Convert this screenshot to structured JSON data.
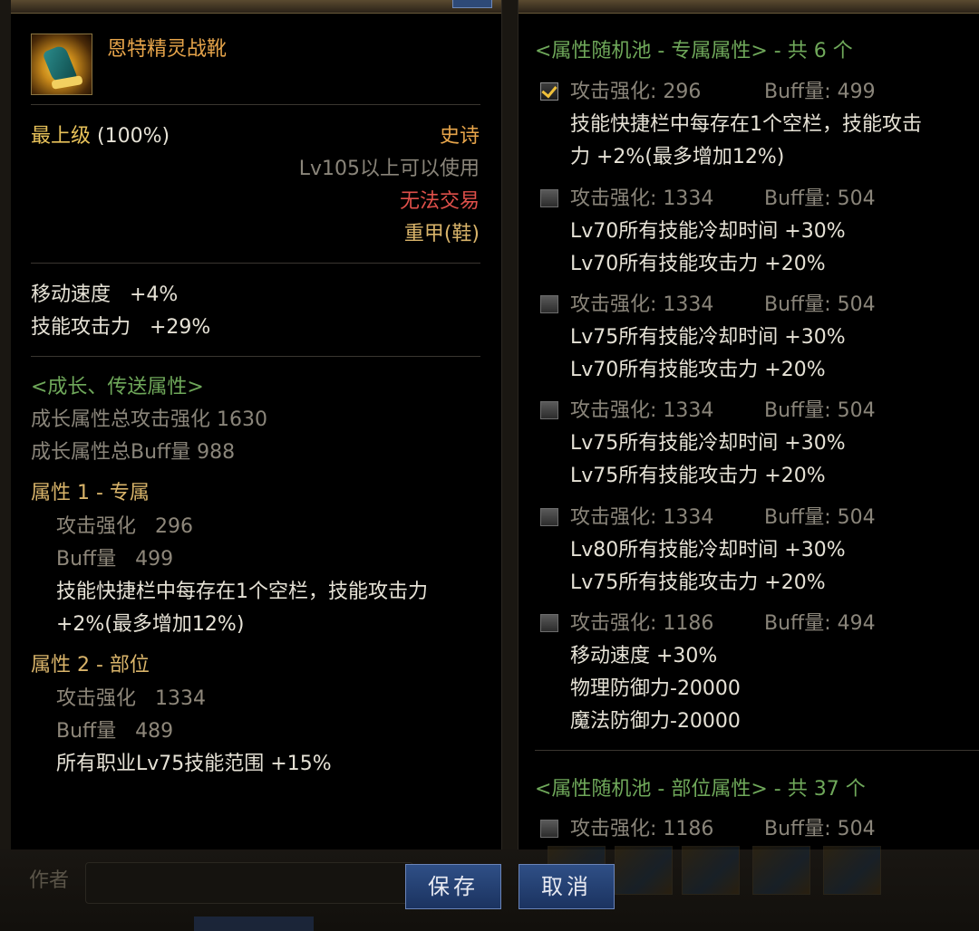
{
  "left": {
    "item_name": "恩特精灵战靴",
    "grade": "最上级",
    "grade_pct": "(100%)",
    "rarity": "史诗",
    "level_req": "Lv105以上可以使用",
    "trade": "无法交易",
    "equip_type": "重甲(鞋)",
    "base_stats": [
      "移动速度   +4%",
      "技能攻击力   +29%"
    ],
    "growth_header": "<成长、传送属性>",
    "growth_total_atk": "成长属性总攻击强化 1630",
    "growth_total_buff": "成长属性总Buff量 988",
    "attr1": {
      "title": "属性 1 - 专属",
      "atk": "攻击强化   296",
      "buff": "Buff量   499",
      "desc1": "技能快捷栏中每存在1个空栏，技能攻击力",
      "desc2": "+2%(最多增加12%)"
    },
    "attr2": {
      "title": "属性 2 - 部位",
      "atk": "攻击强化   1334",
      "buff": "Buff量   489",
      "desc1": "所有职业Lv75技能范围 +15%"
    }
  },
  "right": {
    "pool1_header": "<属性随机池 - 专属属性> - 共 6 个",
    "pool1_items": [
      {
        "atk": "攻击强化: 296",
        "buff": "Buff量: 499",
        "checked": true,
        "lines": [
          "技能快捷栏中每存在1个空栏，技能攻击",
          "力 +2%(最多增加12%)"
        ]
      },
      {
        "atk": "攻击强化: 1334",
        "buff": "Buff量: 504",
        "checked": false,
        "lines": [
          "Lv70所有技能冷却时间 +30%",
          "Lv70所有技能攻击力 +20%"
        ]
      },
      {
        "atk": "攻击强化: 1334",
        "buff": "Buff量: 504",
        "checked": false,
        "lines": [
          "Lv75所有技能冷却时间 +30%",
          "Lv70所有技能攻击力 +20%"
        ]
      },
      {
        "atk": "攻击强化: 1334",
        "buff": "Buff量: 504",
        "checked": false,
        "lines": [
          "Lv75所有技能冷却时间 +30%",
          "Lv75所有技能攻击力 +20%"
        ]
      },
      {
        "atk": "攻击强化: 1334",
        "buff": "Buff量: 504",
        "checked": false,
        "lines": [
          "Lv80所有技能冷却时间 +30%",
          "Lv75所有技能攻击力 +20%"
        ]
      },
      {
        "atk": "攻击强化: 1186",
        "buff": "Buff量: 494",
        "checked": false,
        "lines": [
          "移动速度 +30%",
          "物理防御力-20000",
          "魔法防御力-20000"
        ]
      }
    ],
    "pool2_header": "<属性随机池 - 部位属性> - 共 37 个",
    "pool2_first": {
      "atk": "攻击强化: 1186",
      "buff": "Buff量: 504",
      "checked": false
    }
  },
  "footer": {
    "author_label": "作者",
    "save_label": "保存",
    "cancel_label": "取消"
  }
}
